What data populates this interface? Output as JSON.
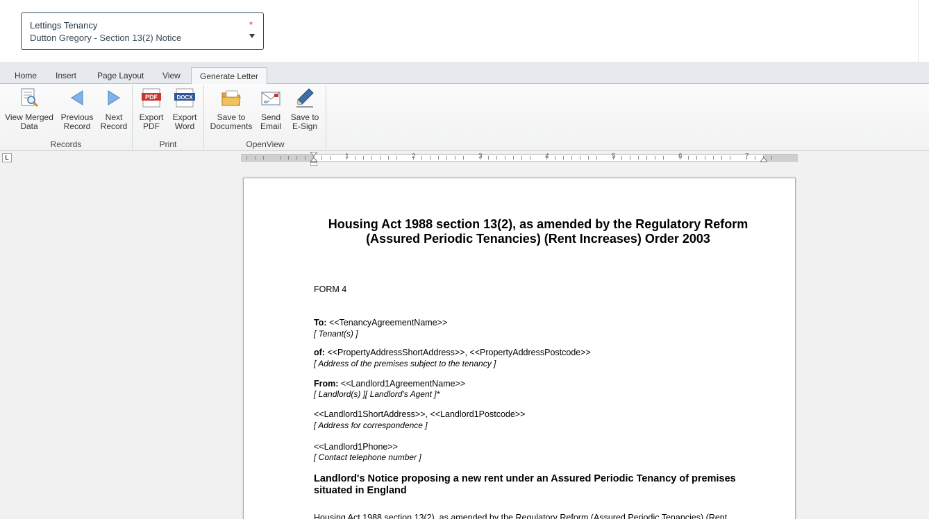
{
  "selector": {
    "label": "Lettings Tenancy",
    "value": "Dutton Gregory - Section 13(2) Notice",
    "required_mark": "*"
  },
  "tabs": [
    {
      "label": "Home",
      "active": false
    },
    {
      "label": "Insert",
      "active": false
    },
    {
      "label": "Page Layout",
      "active": false
    },
    {
      "label": "View",
      "active": false
    },
    {
      "label": "Generate Letter",
      "active": true
    }
  ],
  "ribbon": {
    "groups": [
      {
        "label": "Records",
        "buttons": [
          {
            "label": "View Merged\nData",
            "icon": "view-merged-data-icon"
          },
          {
            "label": "Previous\nRecord",
            "icon": "arrow-left-icon"
          },
          {
            "label": "Next\nRecord",
            "icon": "arrow-right-icon"
          }
        ]
      },
      {
        "label": "Print",
        "buttons": [
          {
            "label": "Export\nPDF",
            "icon": "pdf-icon",
            "badge": "PDF"
          },
          {
            "label": "Export\nWord",
            "icon": "docx-icon",
            "badge": "DOCX"
          }
        ]
      },
      {
        "label": "OpenView",
        "buttons": [
          {
            "label": "Save to\nDocuments",
            "icon": "folder-icon"
          },
          {
            "label": "Send\nEmail",
            "icon": "envelope-icon"
          },
          {
            "label": "Save to\nE-Sign",
            "icon": "pen-icon"
          }
        ]
      }
    ]
  },
  "ruler": {
    "corner": "L",
    "numbers": [
      "1",
      "2",
      "3",
      "4",
      "5",
      "6",
      "7"
    ]
  },
  "document": {
    "title": "Housing Act 1988 section 13(2), as amended by the Regulatory Reform (Assured Periodic Tenancies) (Rent Increases) Order 2003",
    "form": "FORM 4",
    "to_label": "To:",
    "to_value": "<<TenancyAgreementName>>",
    "to_hint": "[ Tenant(s) ]",
    "of_label": "of:",
    "of_value": "<<PropertyAddressShortAddress>>, <<PropertyAddressPostcode>>",
    "of_hint": "[ Address of the premises subject to the tenancy ]",
    "from_label": "From:",
    "from_value": "<<Landlord1AgreementName>>",
    "from_hint": "[ Landlord(s) ][ Landlord's Agent ]*",
    "address_value": "<<Landlord1ShortAddress>>, <<Landlord1Postcode>>",
    "address_hint": "[ Address for correspondence ]",
    "phone_value": "<<Landlord1Phone>>",
    "phone_hint": "[ Contact telephone number ]",
    "section_heading": "Landlord's Notice proposing a new rent under an Assured Periodic Tenancy of premises situated in England",
    "body_start": "Housing Act 1988 section 13(2), as amended by the Regulatory Reform (Assured Periodic Tenancies) (Rent"
  },
  "colors": {
    "selector_border": "#2e4a57",
    "required": "#c0392b",
    "tabbar": "#e6e9ed",
    "canvas": "#f1f1f1"
  }
}
